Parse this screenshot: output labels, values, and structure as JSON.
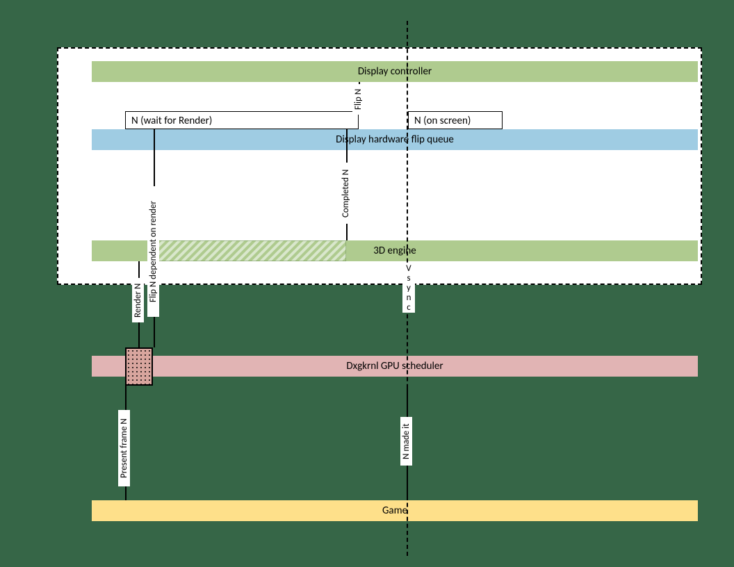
{
  "lanes": {
    "display_controller": "Display controller",
    "flip_queue": "Display hardware flip queue",
    "engine3d": "3D engine",
    "scheduler": "Dxgkrnl GPU scheduler",
    "game": "Game"
  },
  "boxes": {
    "wait_for_render": "N (wait for Render)",
    "on_screen": "N (on screen)"
  },
  "labels": {
    "flip_n": "Flip N",
    "completed_n": "Completed N",
    "flip_dep": "Flip N dependent on render",
    "render_n": "Render N",
    "present_frame_n": "Present frame N",
    "n_made_it": "N made it",
    "vsync": "Vsync"
  },
  "colors": {
    "background": "#366647",
    "green": "#afcb8f",
    "blue": "#9fcce3",
    "pink": "#e1b4b4",
    "yellow": "#fee08a"
  }
}
